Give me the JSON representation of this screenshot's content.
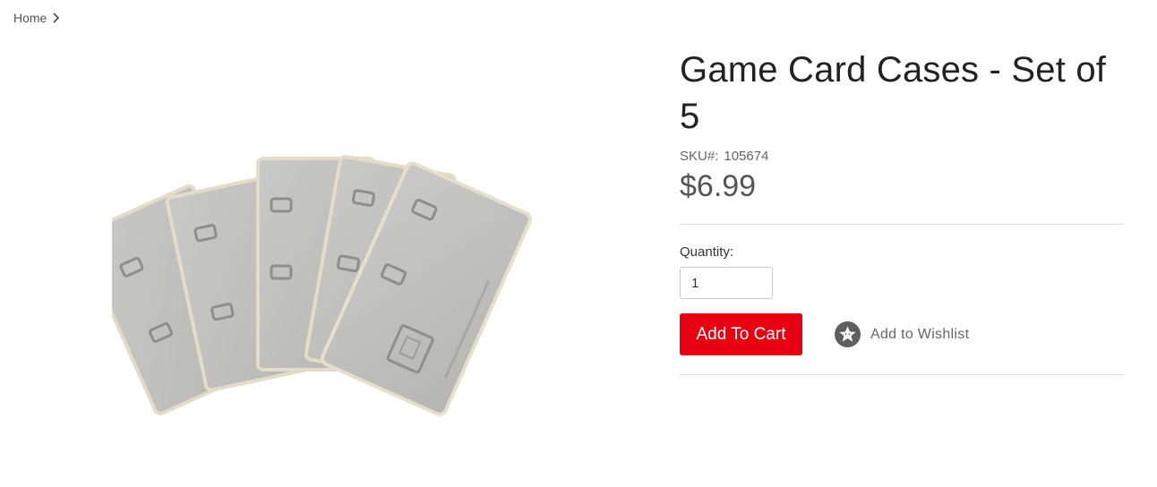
{
  "breadcrumb": {
    "home_label": "Home"
  },
  "product": {
    "title": "Game Card Cases - Set of 5",
    "sku_label": "SKU#:",
    "sku_value": "105674",
    "price": "$6.99",
    "quantity_label": "Quantity:",
    "quantity_value": "1",
    "add_to_cart_label": "Add To Cart",
    "wishlist_label": "Add to Wishlist",
    "image_icon": "game-card-cases-image"
  },
  "colors": {
    "accent": "#e60012",
    "text": "#222222",
    "muted": "#666666",
    "divider": "#dcdcdc"
  }
}
